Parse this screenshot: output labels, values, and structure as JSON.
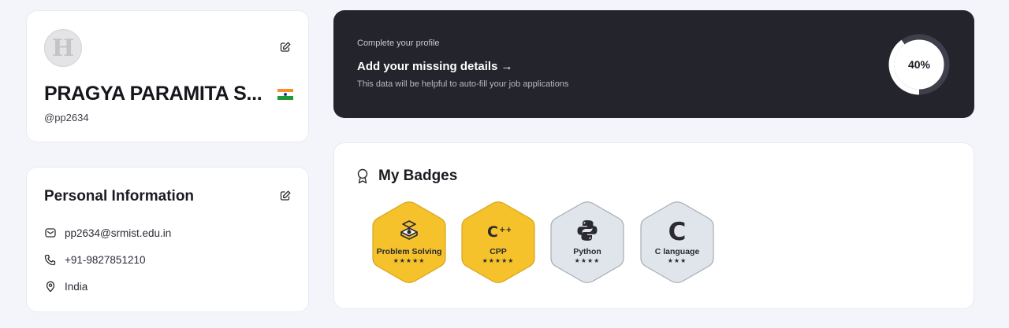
{
  "profile": {
    "avatar_letter": "H",
    "name": "PRAGYA PARAMITA S...",
    "handle": "@pp2634",
    "country_flag": "india-flag-icon"
  },
  "personal_info": {
    "title": "Personal Information",
    "email": "pp2634@srmist.edu.in",
    "phone": "+91-9827851210",
    "country": "India"
  },
  "complete_profile": {
    "label": "Complete your profile",
    "title": "Add your missing details →",
    "description": "This data will be helpful to auto-fill your job applications",
    "progress_text": "40%",
    "progress_percent": 40
  },
  "badges": {
    "title": "My Badges",
    "items": [
      {
        "name": "Problem Solving",
        "stars": "★★★★★",
        "star_count": 5,
        "tier": "gold",
        "icon": "problem-solving-icon"
      },
      {
        "name": "CPP",
        "stars": "★★★★★",
        "star_count": 5,
        "tier": "gold",
        "icon": "cpp-icon"
      },
      {
        "name": "Python",
        "stars": "★★★★",
        "star_count": 4,
        "tier": "silver",
        "icon": "python-icon"
      },
      {
        "name": "C language",
        "stars": "★★★",
        "star_count": 3,
        "tier": "silver",
        "icon": "c-language-icon"
      }
    ]
  },
  "colors": {
    "page_bg": "#f4f5fb",
    "dark_banner": "#24242c",
    "gold_badge": "#f5c22b",
    "silver_badge": "#dfe5ea"
  }
}
